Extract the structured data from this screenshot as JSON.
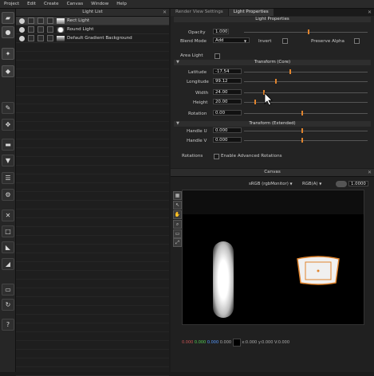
{
  "menu": [
    "Project",
    "Edit",
    "Create",
    "Canvas",
    "Window",
    "Help"
  ],
  "light_list": {
    "title": "Light List",
    "items": [
      {
        "label": "Rect Light",
        "selected": true
      },
      {
        "label": "Round Light",
        "selected": false
      },
      {
        "label": "Default Gradient Background",
        "selected": false
      }
    ]
  },
  "props": {
    "tabs": [
      {
        "label": "Render View Settings",
        "active": false
      },
      {
        "label": "Light Properties",
        "active": true
      }
    ],
    "section_light": "Light Properties",
    "opacity": {
      "label": "Opacity",
      "value": "1.000"
    },
    "blend": {
      "label": "Blend Mode",
      "value": "Add",
      "invert": "Invert",
      "preserve": "Preserve Alpha"
    },
    "area": {
      "label": "Area Light"
    },
    "section_core": "Transform (Core)",
    "latitude": {
      "label": "Latitude",
      "value": "-17.54"
    },
    "longitude": {
      "label": "Longitude",
      "value": "99.12"
    },
    "width": {
      "label": "Width",
      "value": "24.00"
    },
    "height": {
      "label": "Height",
      "value": "20.00"
    },
    "rotation": {
      "label": "Rotation",
      "value": "0.00"
    },
    "section_ext": "Transform (Extended)",
    "handle_u": {
      "label": "Handle U",
      "value": "0.000"
    },
    "handle_v": {
      "label": "Handle V",
      "value": "0.000"
    },
    "rotations": {
      "label": "Rotations",
      "checkbox": "Enable Advanced Rotations"
    }
  },
  "canvas": {
    "title": "Canvas",
    "colorspace": "sRGB (rgbMonitor)",
    "channel": "RGB(A)",
    "exposure": "1.0000",
    "status": {
      "r": "0.000",
      "g": "0.000",
      "b": "0.000",
      "a": "0.000",
      "xy": "x:0.000 y:0.000",
      "v": "V:0.000"
    }
  }
}
